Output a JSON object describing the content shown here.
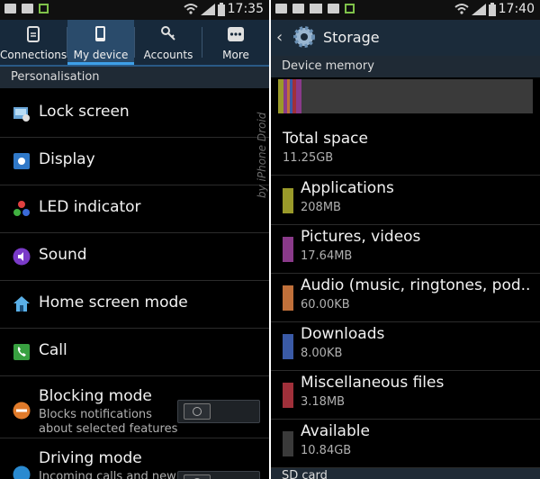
{
  "left": {
    "status": {
      "time": "17:35",
      "icons": [
        "image-icon",
        "image-icon",
        "usb-arrow-icon",
        "wifi-icon",
        "signal-icon",
        "battery-icon"
      ]
    },
    "tabs": [
      {
        "label": "Connections",
        "icon": "connections-icon",
        "selected": false
      },
      {
        "label": "My device",
        "icon": "device-icon",
        "selected": true
      },
      {
        "label": "Accounts",
        "icon": "key-icon",
        "selected": false
      },
      {
        "label": "More",
        "icon": "more-dots-icon",
        "selected": false
      }
    ],
    "section_label": "Personalisation",
    "items": [
      {
        "label": "Lock screen",
        "icon": "lock-screen-icon"
      },
      {
        "label": "Display",
        "icon": "display-icon"
      },
      {
        "label": "LED indicator",
        "icon": "led-icon"
      },
      {
        "label": "Sound",
        "icon": "sound-icon"
      },
      {
        "label": "Home screen mode",
        "icon": "home-icon"
      },
      {
        "label": "Call",
        "icon": "call-icon"
      }
    ],
    "blocking": {
      "label": "Blocking mode",
      "subtitle_line1": "Blocks notifications",
      "subtitle_line2": "about selected features",
      "toggle": "off"
    },
    "driving": {
      "label": "Driving mode",
      "subtitle_partial": "Incoming calls and new"
    }
  },
  "right": {
    "status": {
      "time": "17:40",
      "icons": [
        "image-icon",
        "image-icon",
        "mail-icon",
        "image-icon",
        "usb-arrow-icon",
        "wifi-icon",
        "signal-icon",
        "battery-icon"
      ]
    },
    "title": "Storage",
    "section_label": "Device memory",
    "total": {
      "label": "Total space",
      "value": "11.25GB"
    },
    "categories": [
      {
        "label": "Applications",
        "value": "208MB",
        "color": "#9a9a2a"
      },
      {
        "label": "Pictures, videos",
        "value": "17.64MB",
        "color": "#8a3a8a"
      },
      {
        "label": "Audio (music, ringtones, pod..",
        "value": "60.00KB",
        "color": "#c0703a"
      },
      {
        "label": "Downloads",
        "value": "8.00KB",
        "color": "#3a5aa6"
      },
      {
        "label": "Miscellaneous files",
        "value": "3.18MB",
        "color": "#a0303a"
      },
      {
        "label": "Available",
        "value": "10.84GB",
        "color": "#3a3a3a"
      }
    ],
    "next_section_partial": "SD card"
  },
  "watermark": "by iPhone Droid",
  "colors": {
    "accent": "#3ea0e8",
    "tab_bg": "#17293b",
    "section_bg": "#1f2a35"
  }
}
